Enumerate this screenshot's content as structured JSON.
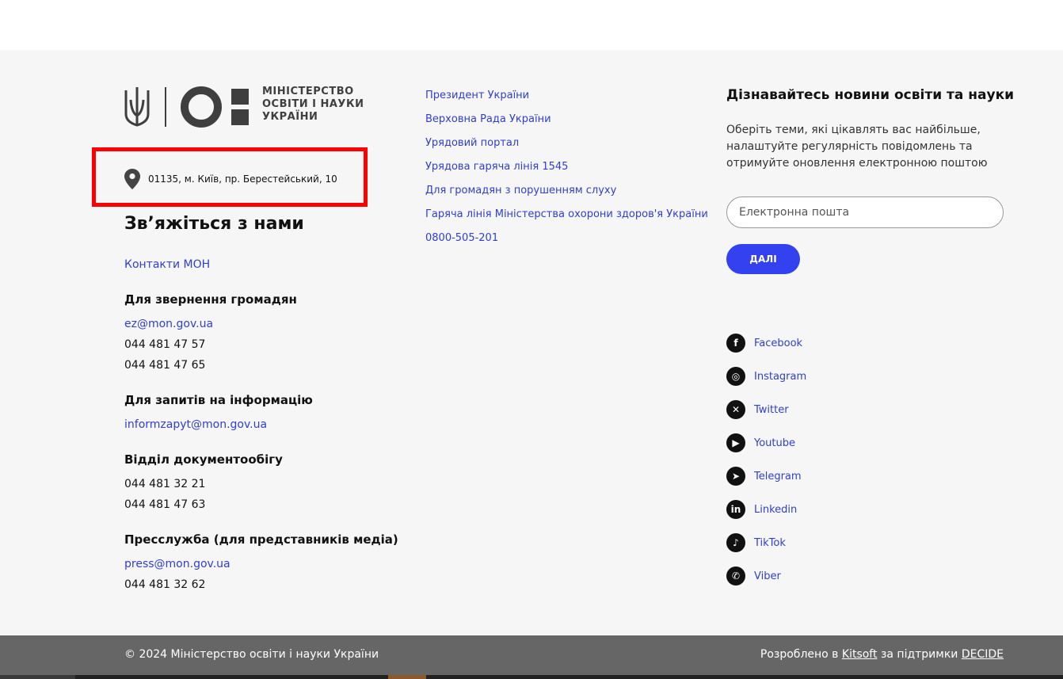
{
  "logo": {
    "text": "МІНІСТЕРСТВО\nОСВІТИ І НАУКИ\nУКРАЇНИ",
    "colors": {
      "mark": "#3f3f3f"
    },
    "icons": [
      "trident-icon",
      "mon-logo-mark"
    ]
  },
  "address": {
    "text": "01135, м. Київ, пр. Берестейський, 10",
    "icon": "location-pin-icon"
  },
  "contacts": {
    "title": "Зв’яжіться з нами",
    "contacts_link": "Контакти МОН",
    "citizens": {
      "heading": "Для звернення громадян",
      "email": "ez@mon.gov.ua",
      "phones": [
        "044 481 47 57",
        "044 481 47 65"
      ]
    },
    "info_requests": {
      "heading": "Для запитів на інформацію",
      "email": "informzapyt@mon.gov.ua"
    },
    "docs": {
      "heading": "Відділ документообігу",
      "phones": [
        "044 481 32 21",
        "044 481 47 63"
      ]
    },
    "press": {
      "heading": "Пресслужба (для представників медіа)",
      "email": "press@mon.gov.ua",
      "phone": "044 481 32 62"
    }
  },
  "links": [
    "Президент України",
    "Верховна Рада України",
    "Урядовий портал",
    "Урядова гаряча лінія 1545",
    "Для громадян з порушенням слуху",
    "Гаряча лінія Міністерства охорони здоров'я України",
    "0800-505-201"
  ],
  "newsletter": {
    "title": "Дізнавайтесь новини освіти та науки",
    "description": "Оберіть теми, які цікавлять вас найбільше, налаштуйте регулярність повідомлень та отримуйте оновлення електронною поштою",
    "placeholder": "Електронна пошта",
    "button": "ДАЛІ"
  },
  "social": [
    {
      "label": "Facebook",
      "icon": "facebook-icon",
      "glyph": "f"
    },
    {
      "label": "Instagram",
      "icon": "instagram-icon",
      "glyph": "◎"
    },
    {
      "label": "Twitter",
      "icon": "x-twitter-icon",
      "glyph": "✕"
    },
    {
      "label": "Youtube",
      "icon": "youtube-icon",
      "glyph": "▶"
    },
    {
      "label": "Telegram",
      "icon": "telegram-icon",
      "glyph": "➤"
    },
    {
      "label": "Linkedin",
      "icon": "linkedin-icon",
      "glyph": "in"
    },
    {
      "label": "TikTok",
      "icon": "tiktok-icon",
      "glyph": "♪"
    },
    {
      "label": "Viber",
      "icon": "viber-icon",
      "glyph": "✆"
    }
  ],
  "bottom": {
    "copyright": "© 2024 Міністерство освіти і науки України",
    "developed_prefix": "Розроблено в",
    "developer": "Kitsoft",
    "support_prefix": "за підтримки",
    "supporter": "DECIDE"
  },
  "colors": {
    "link": "#2f3fd0",
    "button": "#3441f0",
    "footer_bg": "#f6f6f6",
    "bottom_bar": "#666666",
    "highlight": "#ff0000"
  }
}
